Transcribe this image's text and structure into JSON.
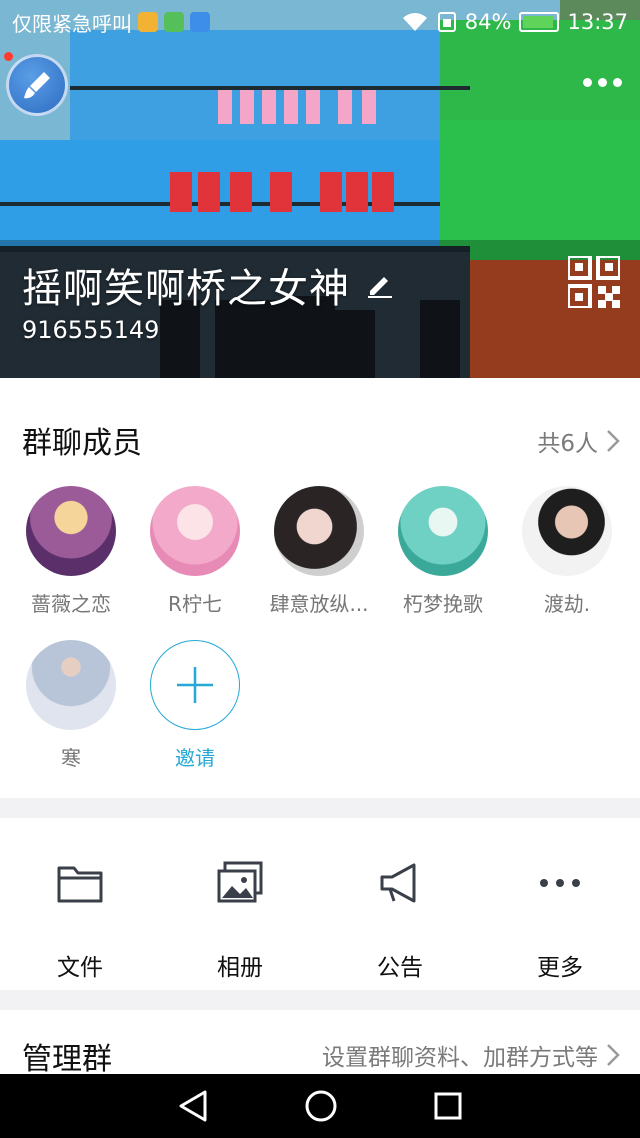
{
  "statusbar": {
    "carrier": "仅限紧急呼叫",
    "battery": "84%",
    "time": "13:37",
    "battery_level": 0.84
  },
  "header": {
    "group_name": "摇啊笑啊桥之女神",
    "group_id": "916555149",
    "icons": [
      "edit-icon",
      "qr-code-icon",
      "more-icon"
    ]
  },
  "members": {
    "title": "群聊成员",
    "count": "共6人",
    "list": [
      {
        "name": "蔷薇之恋"
      },
      {
        "name": "R柠七"
      },
      {
        "name": "肆意放纵..."
      },
      {
        "name": "朽梦挽歌"
      },
      {
        "name": "渡劫."
      },
      {
        "name": "寒"
      }
    ],
    "invite_label": "邀请"
  },
  "tools": {
    "items": [
      {
        "label": "文件",
        "icon": "folder-icon"
      },
      {
        "label": "相册",
        "icon": "album-icon"
      },
      {
        "label": "公告",
        "icon": "announcement-icon"
      },
      {
        "label": "更多",
        "icon": "more-icon"
      }
    ]
  },
  "manage": {
    "title": "管理群",
    "desc": "设置群聊资料、加群方式等"
  },
  "colors": {
    "accent": "#25a8d6",
    "muted_text": "#7a7a7a",
    "background": "#f2f2f4"
  }
}
